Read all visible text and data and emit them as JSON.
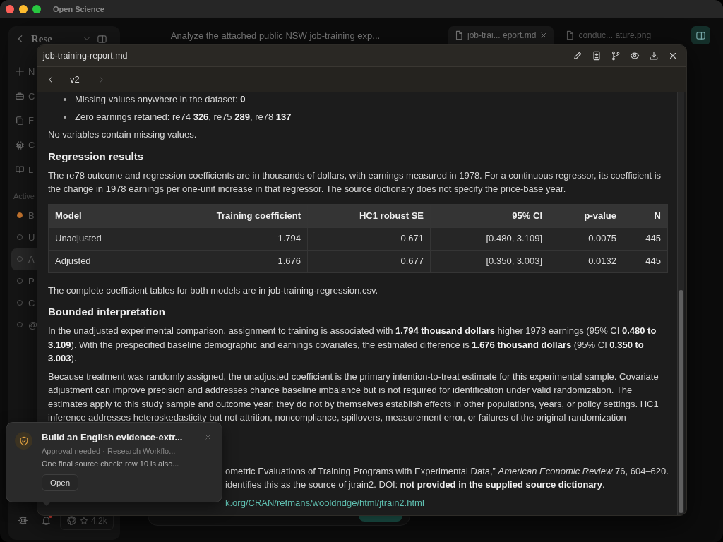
{
  "window": {
    "title": "Open Science"
  },
  "sidebar": {
    "title": "Rese",
    "items": [
      {
        "label": "N"
      },
      {
        "label": "C"
      },
      {
        "label": "F"
      },
      {
        "label": "C"
      },
      {
        "label": "L"
      }
    ],
    "section_label": "Active",
    "tasks": [
      {
        "label": "B",
        "running": true,
        "selected": false
      },
      {
        "label": "U",
        "running": false,
        "selected": false
      },
      {
        "label": "A",
        "running": false,
        "selected": true
      },
      {
        "label": "P",
        "running": false,
        "selected": false
      },
      {
        "label": "C",
        "running": false,
        "selected": false
      },
      {
        "label": "@",
        "running": false,
        "selected": false
      }
    ],
    "footer": {
      "star_count": "4.2k",
      "has_notification": true
    }
  },
  "chat": {
    "prompt": "Analyze the attached public NSW job-training exp..."
  },
  "tabs": [
    {
      "label": "job-trai... eport.md",
      "selected": true,
      "closable": true
    },
    {
      "label": "conduc... ature.png",
      "selected": false,
      "closable": false
    }
  ],
  "panel_toggle": {
    "on": true
  },
  "document": {
    "title": "job-training-report.md",
    "version": "v2",
    "prev_enabled": true,
    "next_enabled": false,
    "blocks": [
      {
        "kind": "bullets",
        "items": [
          "Missing values anywhere in the dataset: **0**",
          "Zero earnings retained: re74 **326**, re75 **289**, re78 **137**"
        ]
      },
      {
        "kind": "paragraph",
        "text": "No variables contain missing values."
      },
      {
        "kind": "heading",
        "text": "Regression results"
      },
      {
        "kind": "paragraph",
        "text": "The re78 outcome and regression coefficients are in thousands of dollars, with earnings measured in 1978. For a continuous regressor, its coefficient is the change in 1978 earnings per one-unit increase in that regressor. The source dictionary does not specify the price-base year."
      },
      {
        "kind": "table",
        "columns": [
          "Model",
          "Training coefficient",
          "HC1 robust SE",
          "95% CI",
          "p-value",
          "N"
        ],
        "rows": [
          [
            "Unadjusted",
            "1.794",
            "0.671",
            "[0.480, 3.109]",
            "0.0075",
            "445"
          ],
          [
            "Adjusted",
            "1.676",
            "0.677",
            "[0.350, 3.003]",
            "0.0132",
            "445"
          ]
        ]
      },
      {
        "kind": "paragraph",
        "text": "The complete coefficient tables for both models are in job-training-regression.csv."
      },
      {
        "kind": "heading",
        "text": "Bounded interpretation"
      },
      {
        "kind": "paragraph",
        "text": "In the unadjusted experimental comparison, assignment to training is associated with **1.794 thousand dollars** higher 1978 earnings (95% CI **0.480 to 3.109**). With the prespecified baseline demographic and earnings covariates, the estimated difference is **1.676 thousand dollars** (95% CI **0.350 to 3.003**)."
      },
      {
        "kind": "paragraph",
        "text": "Because treatment was randomly assigned, the unadjusted coefficient is the primary intention-to-treat estimate for this experimental sample. Covariate adjustment can improve precision and addresses chance baseline imbalance but is not required for identification under valid randomization. The estimates apply to this study sample and outcome year; they do not by themselves establish effects in other populations, years, or policy settings. HC1 inference addresses heteroskedasticity but not attrition, noncompliance, spillovers, measurement error, or failures of the original randomization"
      },
      {
        "kind": "fragments",
        "lines": [
          {
            "text": "ometric Evaluations of Training Programs with Experimental Data,” *American Economic Review* 76, 604–620.",
            "link": false
          },
          {
            "text": "identifies this as the source of jtrain2. DOI: **not provided in the supplied source dictionary**.",
            "link": false
          },
          {
            "text": "k.org/CRAN/refmans/wooldridge/html/jtrain2.html",
            "link": true
          }
        ]
      }
    ]
  },
  "toast": {
    "title": "Build an English evidence-extr...",
    "subtitle": "Approval needed · Research Workflo...",
    "message": "One final source check: row 10 is also...",
    "button": "Open"
  }
}
